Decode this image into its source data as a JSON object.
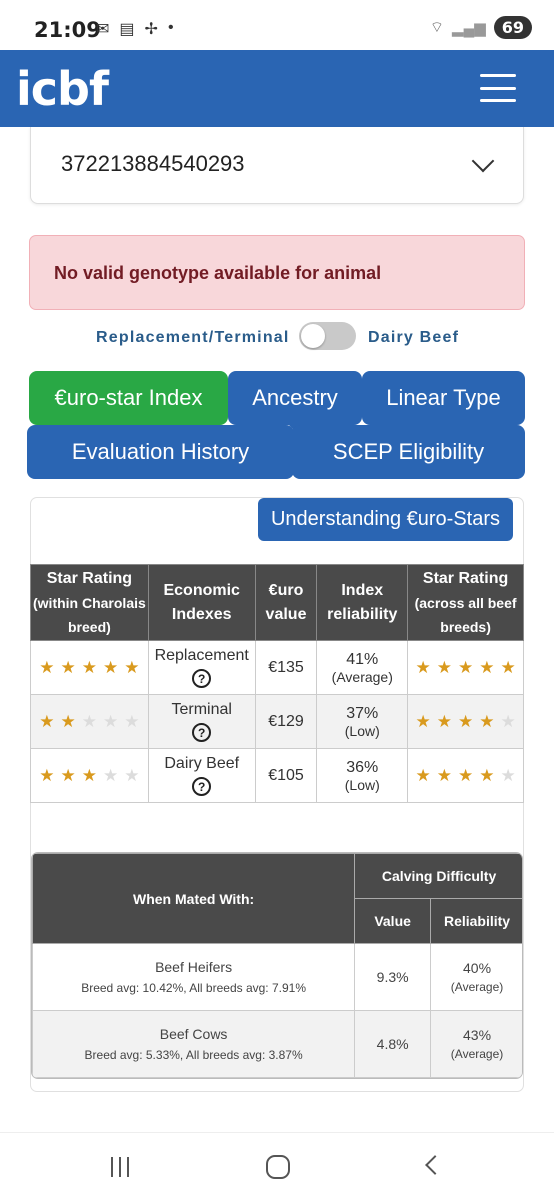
{
  "status_bar": {
    "time": "21:09",
    "battery": "69",
    "icons_left": [
      "mail-icon",
      "calendar-icon",
      "fan-icon",
      "dot-icon"
    ],
    "icons_right": [
      "wifi-icon",
      "signal-icon"
    ]
  },
  "header": {
    "logo": "icbf"
  },
  "animal_select": {
    "value": "372213884540293"
  },
  "alert": {
    "text": "No valid genotype available for animal"
  },
  "toggle": {
    "left_label": "Replacement/Terminal",
    "right_label": "Dairy Beef",
    "checked": false
  },
  "tabs": [
    {
      "label": "€uro-star Index",
      "active": true
    },
    {
      "label": "Ancestry",
      "active": false
    },
    {
      "label": "Linear Type",
      "active": false
    },
    {
      "label": "Evaluation History",
      "active": false
    },
    {
      "label": "SCEP Eligibility",
      "active": false
    }
  ],
  "understanding_button": "Understanding €uro-Stars",
  "index_table": {
    "headers": {
      "star_within": "Star Rating",
      "star_within_sub": "(within Charolais breed)",
      "economic": "Economic Indexes",
      "euro": "€uro value",
      "reliability": "Index reliability",
      "star_across": "Star Rating",
      "star_across_sub": "(across all beef breeds)"
    },
    "rows": [
      {
        "stars_within": 5,
        "index": "Replacement",
        "value": "€135",
        "reliability": "41%",
        "reliability_label": "(Average)",
        "stars_across": 5
      },
      {
        "stars_within": 2,
        "index": "Terminal",
        "value": "€129",
        "reliability": "37%",
        "reliability_label": "(Low)",
        "stars_across": 4
      },
      {
        "stars_within": 3,
        "index": "Dairy Beef",
        "value": "€105",
        "reliability": "36%",
        "reliability_label": "(Low)",
        "stars_across": 4
      }
    ]
  },
  "calving_table": {
    "headers": {
      "mated_with": "When Mated With:",
      "calving": "Calving Difficulty",
      "value": "Value",
      "reliability": "Reliability"
    },
    "rows": [
      {
        "label": "Beef Heifers",
        "sub": "Breed avg: 10.42%, All breeds avg: 7.91%",
        "value": "9.3%",
        "reliability": "40%",
        "reliability_label": "(Average)"
      },
      {
        "label": "Beef Cows",
        "sub": "Breed avg: 5.33%, All breeds avg: 3.87%",
        "value": "4.8%",
        "reliability": "43%",
        "reliability_label": "(Average)"
      }
    ]
  }
}
